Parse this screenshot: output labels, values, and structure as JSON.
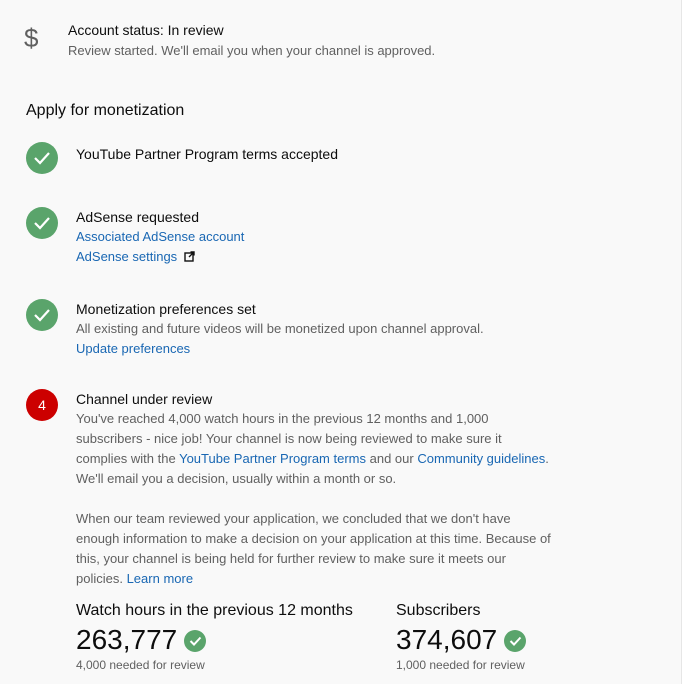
{
  "account_status": {
    "icon": "dollar-icon",
    "title": "Account status: In review",
    "subtitle": "Review started. We'll email you when your channel is approved."
  },
  "section_title": "Apply for monetization",
  "steps": {
    "terms": {
      "title": "YouTube Partner Program terms accepted"
    },
    "adsense": {
      "title": "AdSense requested",
      "link1": "Associated AdSense account",
      "link2": "AdSense settings"
    },
    "preferences": {
      "title": "Monetization preferences set",
      "desc": "All existing and future videos will be monetized upon channel approval.",
      "link": "Update preferences"
    },
    "review": {
      "number": "4",
      "title": "Channel under review",
      "p1_a": "You've reached 4,000 watch hours in the previous 12 months and 1,000 subscribers - nice job! Your channel is now being reviewed to make sure it complies with the ",
      "p1_link1": "YouTube Partner Program terms",
      "p1_b": " and our ",
      "p1_link2": "Community guidelines",
      "p1_c": ". We'll email you a decision, usually within a month or so.",
      "p2": "When our team reviewed your application, we concluded that we don't have enough information to make a decision on your application at this time. Because of this, your channel is being held for further review to make sure it meets our policies. ",
      "p2_link": "Learn more"
    }
  },
  "stats": {
    "watch": {
      "label": "Watch hours in the previous 12 months",
      "value": "263,777",
      "needed": "4,000 needed for review"
    },
    "subs": {
      "label": "Subscribers",
      "value": "374,607",
      "needed": "1,000 needed for review"
    }
  },
  "colors": {
    "success": "#5aa46b",
    "alert": "#cc0000",
    "link": "#1967b3",
    "muted": "#606060"
  }
}
